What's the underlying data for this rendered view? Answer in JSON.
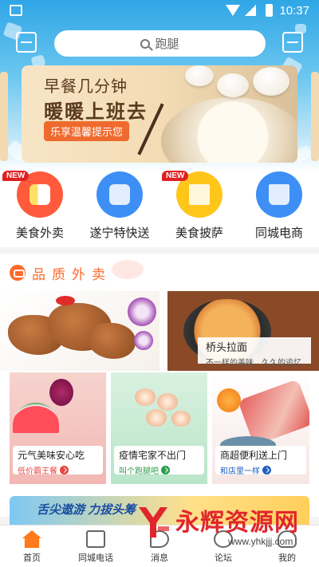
{
  "status_bar": {
    "time": "10:37"
  },
  "search": {
    "placeholder": "跑腿"
  },
  "banner": {
    "line1": "早餐几分钟",
    "line2": "暖暖上班去",
    "tag": "乐享温馨提示您"
  },
  "categories": [
    {
      "label": "美食外卖",
      "badge": "NEW",
      "color": "#ff5a3c",
      "icon": "food-delivery-icon"
    },
    {
      "label": "遂宁特快送",
      "badge": "",
      "color": "#3d8ff5",
      "icon": "express-box-icon"
    },
    {
      "label": "美食披萨",
      "badge": "NEW",
      "color": "#ffc61a",
      "icon": "pizza-milk-icon"
    },
    {
      "label": "同城电商",
      "badge": "",
      "color": "#3d8ff5",
      "icon": "shop-icon"
    }
  ],
  "quality": {
    "title": "品质外卖",
    "big_tiles": [
      {
        "name": "",
        "desc": ""
      },
      {
        "name": "桥头拉面",
        "desc": "不一样的美味、久久的追忆"
      }
    ],
    "small_tiles": [
      {
        "title": "元气美味安心吃",
        "sub": "低价霸王餐",
        "accent": "#e8453c"
      },
      {
        "title": "疫情宅家不出门",
        "sub": "叫个跑腿吧",
        "accent": "#2b9e4a"
      },
      {
        "title": "商超便利送上门",
        "sub": "和店里一样",
        "accent": "#1e5fbf"
      }
    ]
  },
  "promo": {
    "text": "舌尖遨游 力拔头筹"
  },
  "tabs": [
    {
      "label": "首页",
      "icon": "home-icon",
      "active": true
    },
    {
      "label": "同城电话",
      "icon": "phonebook-icon",
      "active": false
    },
    {
      "label": "消息",
      "icon": "message-icon",
      "active": false
    },
    {
      "label": "论坛",
      "icon": "forum-icon",
      "active": false
    },
    {
      "label": "我的",
      "icon": "profile-icon",
      "active": false
    }
  ],
  "watermark": {
    "brand": "永辉资源网",
    "url": "www.yhkjjj.com"
  }
}
